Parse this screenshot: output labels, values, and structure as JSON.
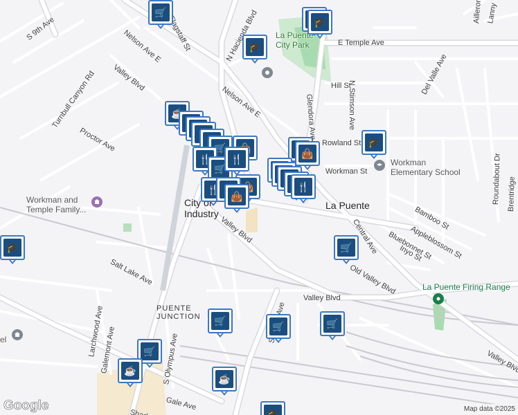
{
  "map": {
    "colors": {
      "land": "#f4f3f6",
      "road": "#ffffff",
      "road_edge": "#d9d9de",
      "park": "#cde9cf",
      "park_dark": "#a8dcb0",
      "rail": "#c9c9ce",
      "pin_border": "#3a78c6",
      "pin_fill": "#1a4d80",
      "poi_gray": "#7f8890",
      "poi_green": "#1b7e4c"
    },
    "labels": [
      {
        "id": "s-9th-ave",
        "text": "S 9th Ave",
        "cls": "",
        "rot": -38
      },
      {
        "id": "flagstaff-st",
        "text": "Flagstaff St",
        "cls": "",
        "rot": 62
      },
      {
        "id": "nelson-ave-e-1",
        "text": "Nelson Ave E",
        "cls": "",
        "rot": 40
      },
      {
        "id": "n-hacienda-blvd",
        "text": "N Hacienda Blvd",
        "cls": "",
        "rot": -62
      },
      {
        "id": "la-puente-city-park",
        "text": "La Puente\nCity Park",
        "cls": "park",
        "rot": 0
      },
      {
        "id": "e-temple-ave",
        "text": "E Temple Ave",
        "cls": "",
        "rot": 0
      },
      {
        "id": "glendora-ave",
        "text": "Glendora Ave",
        "cls": "",
        "rot": 85
      },
      {
        "id": "n-stimson-ave",
        "text": "N Stimson Ave",
        "cls": "",
        "rot": 90
      },
      {
        "id": "del-valle-ave",
        "text": "Del Valle Ave",
        "cls": "",
        "rot": -62
      },
      {
        "id": "lanny",
        "text": "Lanny",
        "cls": "",
        "rot": -80
      },
      {
        "id": "ailleron",
        "text": "Ailleron",
        "cls": "",
        "rot": -85
      },
      {
        "id": "hill-st",
        "text": "Hill St",
        "cls": "",
        "rot": 0
      },
      {
        "id": "valley-blvd-1",
        "text": "Valley Blvd",
        "cls": "",
        "rot": 38
      },
      {
        "id": "turnbull-canyon-rd",
        "text": "Turnbull Canyon Rd",
        "cls": "",
        "rot": -55
      },
      {
        "id": "nelson-ave-e-2",
        "text": "Nelson Ave E",
        "cls": "",
        "rot": 37
      },
      {
        "id": "proctor-ave",
        "text": "Proctor Ave",
        "cls": "",
        "rot": 30
      },
      {
        "id": "rowland-st",
        "text": "Rowland St",
        "cls": "",
        "rot": 0
      },
      {
        "id": "workman-st",
        "text": "Workman St",
        "cls": "",
        "rot": 0
      },
      {
        "id": "workman-elementary",
        "text": "Workman\nElementary School",
        "cls": "poi",
        "rot": 0
      },
      {
        "id": "workman-temple",
        "text": "Workman and\nTemple Family...",
        "cls": "poi",
        "rot": 0
      },
      {
        "id": "city-of-industry",
        "text": "City of\nIndustry",
        "cls": "city",
        "rot": 0
      },
      {
        "id": "la-puente",
        "text": "La Puente",
        "cls": "city",
        "rot": 0
      },
      {
        "id": "bamboo-st",
        "text": "Bamboo St",
        "cls": "",
        "rot": 30
      },
      {
        "id": "roundabout-dr",
        "text": "Roundabout Dr",
        "cls": "",
        "rot": -88
      },
      {
        "id": "brentridge",
        "text": "Brentridge",
        "cls": "",
        "rot": -88
      },
      {
        "id": "appleblossom-st",
        "text": "Appleblossom St",
        "cls": "",
        "rot": 30
      },
      {
        "id": "central-ave",
        "text": "Central Ave",
        "cls": "",
        "rot": 58
      },
      {
        "id": "bluebonnet-st",
        "text": "Bluebonnet St",
        "cls": "",
        "rot": 30
      },
      {
        "id": "inyo-st",
        "text": "Inyo St",
        "cls": "",
        "rot": 30
      },
      {
        "id": "valley-blvd-2",
        "text": "Valley Blvd",
        "cls": "",
        "rot": 38
      },
      {
        "id": "salt-lake-ave",
        "text": "Salt Lake Ave",
        "cls": "",
        "rot": 28
      },
      {
        "id": "old-valley-blvd",
        "text": "Old Valley Blvd",
        "cls": "",
        "rot": 30
      },
      {
        "id": "valley-blvd-3",
        "text": "Valley Blvd",
        "cls": "",
        "rot": 0
      },
      {
        "id": "la-puente-firing-range",
        "text": "La Puente Firing Range",
        "cls": "range",
        "rot": 0
      },
      {
        "id": "puente-junction",
        "text": "PUENTE\nJUNCTION",
        "cls": "caps",
        "rot": 0
      },
      {
        "id": "larchwood-ave",
        "text": "Larchwood Ave",
        "cls": "",
        "rot": -80
      },
      {
        "id": "galemont-ave",
        "text": "Galemont Ave",
        "cls": "",
        "rot": -80
      },
      {
        "id": "s-olympus-ave",
        "text": "S Olympus Ave",
        "cls": "",
        "rot": -80
      },
      {
        "id": "stimson-ave",
        "text": "Stimson Ave",
        "cls": "",
        "rot": -75
      },
      {
        "id": "valley-blvd-4",
        "text": "Valley Blvd",
        "cls": "",
        "rot": 30
      },
      {
        "id": "gale-ave",
        "text": "Gale Ave",
        "cls": "",
        "rot": 15
      },
      {
        "id": "shadow",
        "text": "Shad",
        "cls": "",
        "rot": 15
      },
      {
        "id": "el",
        "text": "el",
        "cls": "poi",
        "rot": 0
      }
    ],
    "pins": [
      {
        "kind": "shopping-cart",
        "icon": "🛒"
      },
      {
        "kind": "graduation-cap",
        "icon": "🎓"
      },
      {
        "kind": "graduation-cap",
        "icon": "🎓"
      },
      {
        "kind": "graduation-cap",
        "icon": "🎓"
      },
      {
        "kind": "coffee",
        "icon": "☕"
      },
      {
        "kind": "restaurant",
        "icon": "🍴"
      },
      {
        "kind": "restaurant",
        "icon": "🍴"
      },
      {
        "kind": "restaurant",
        "icon": "🍴"
      },
      {
        "kind": "restaurant",
        "icon": "🍴"
      },
      {
        "kind": "shopping-bag",
        "icon": "👜"
      },
      {
        "kind": "shopping-cart",
        "icon": "🛒"
      },
      {
        "kind": "restaurant",
        "icon": "🍴"
      },
      {
        "kind": "shopping-cart",
        "icon": "🛒"
      },
      {
        "kind": "restaurant",
        "icon": "🍴"
      },
      {
        "kind": "restaurant",
        "icon": "🍴"
      },
      {
        "kind": "shopping-bag",
        "icon": "👜"
      },
      {
        "kind": "restaurant",
        "icon": "🍴"
      },
      {
        "kind": "restaurant",
        "icon": "🍴"
      },
      {
        "kind": "restaurant",
        "icon": "🍴"
      },
      {
        "kind": "restaurant",
        "icon": "🍴"
      },
      {
        "kind": "restaurant",
        "icon": "🍴"
      },
      {
        "kind": "shopping-bag",
        "icon": "👜"
      },
      {
        "kind": "restaurant",
        "icon": "🍴"
      },
      {
        "kind": "restaurant",
        "icon": "🍴"
      },
      {
        "kind": "shopping-bag",
        "icon": "👜"
      },
      {
        "kind": "graduation-cap",
        "icon": "🎓"
      },
      {
        "kind": "shopping-cart",
        "icon": "🛒"
      },
      {
        "kind": "graduation-cap",
        "icon": "🎓"
      },
      {
        "kind": "shopping-cart",
        "icon": "🛒"
      },
      {
        "kind": "shopping-cart",
        "icon": "🛒"
      },
      {
        "kind": "shopping-cart",
        "icon": "🛒"
      },
      {
        "kind": "shopping-cart",
        "icon": "🛒"
      },
      {
        "kind": "coffee",
        "icon": "☕"
      },
      {
        "kind": "coffee",
        "icon": "☕"
      },
      {
        "kind": "graduation-cap",
        "icon": "🎓"
      }
    ],
    "attribution": "Map data ©2025",
    "google_logo": "Google"
  }
}
